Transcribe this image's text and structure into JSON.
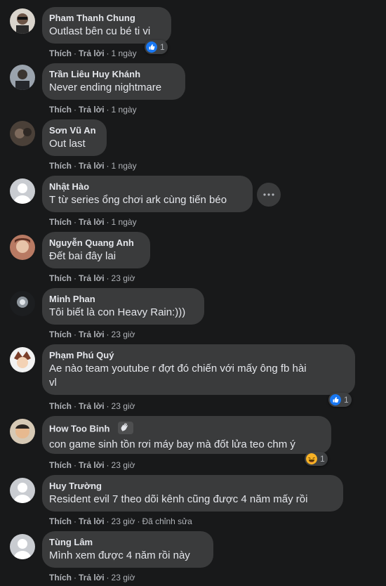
{
  "colors": {
    "background": "#18191a",
    "bubble": "#3a3b3c",
    "text": "#e4e6eb",
    "secondary": "#b0b3b8",
    "like_blue": "#1877f2"
  },
  "actions": {
    "like": "Thích",
    "reply": "Trả lời",
    "edited": "Đã chỉnh sửa"
  },
  "comments": [
    {
      "author": "Pham Thanh Chung",
      "text": "Outlast bên cu bé ti vi",
      "time": "1 ngày",
      "reaction": {
        "icon": "like-icon",
        "count": "1"
      }
    },
    {
      "author": "Trần Liêu Huy Khánh",
      "text": "Never ending nightmare",
      "time": "1 ngày"
    },
    {
      "author": "Sơn Vũ An",
      "text": "Out last",
      "time": "1 ngày"
    },
    {
      "author": "Nhật Hào",
      "text": "T từ series ổng chơi ark cùng tiến béo",
      "time": "1 ngày",
      "more_icon": "more-horizontal-icon"
    },
    {
      "author": "Nguyễn Quang Anh",
      "text": "Đết bai đây lai",
      "time": "23 giờ"
    },
    {
      "author": "Minh Phan",
      "text": "Tôi biết là con Heavy Rain:)))",
      "time": "23 giờ"
    },
    {
      "author": "Phạm Phú Quý",
      "text_line1": "Ae nào team youtube r đợt đó chiến với mấy ông fb hài",
      "text_line2": "vl",
      "time": "23 giờ",
      "reaction": {
        "icon": "like-icon",
        "count": "1"
      }
    },
    {
      "author": "How Too Binh",
      "badge_icon": "waving-hand-badge-icon",
      "text": "con game sinh tồn rơi máy bay mà đốt lửa teo chm ý",
      "time": "23 giờ",
      "reaction": {
        "icon": "haha-icon",
        "count": "1"
      }
    },
    {
      "author": "Huy Trường",
      "text": "Resident evil 7 theo dõi kênh cũng được 4 năm mấy rồi",
      "time": "23 giờ"
    },
    {
      "author": "Tùng Lâm",
      "text": "Mình xem được 4 năm rồi này",
      "time": "23 giờ"
    }
  ]
}
